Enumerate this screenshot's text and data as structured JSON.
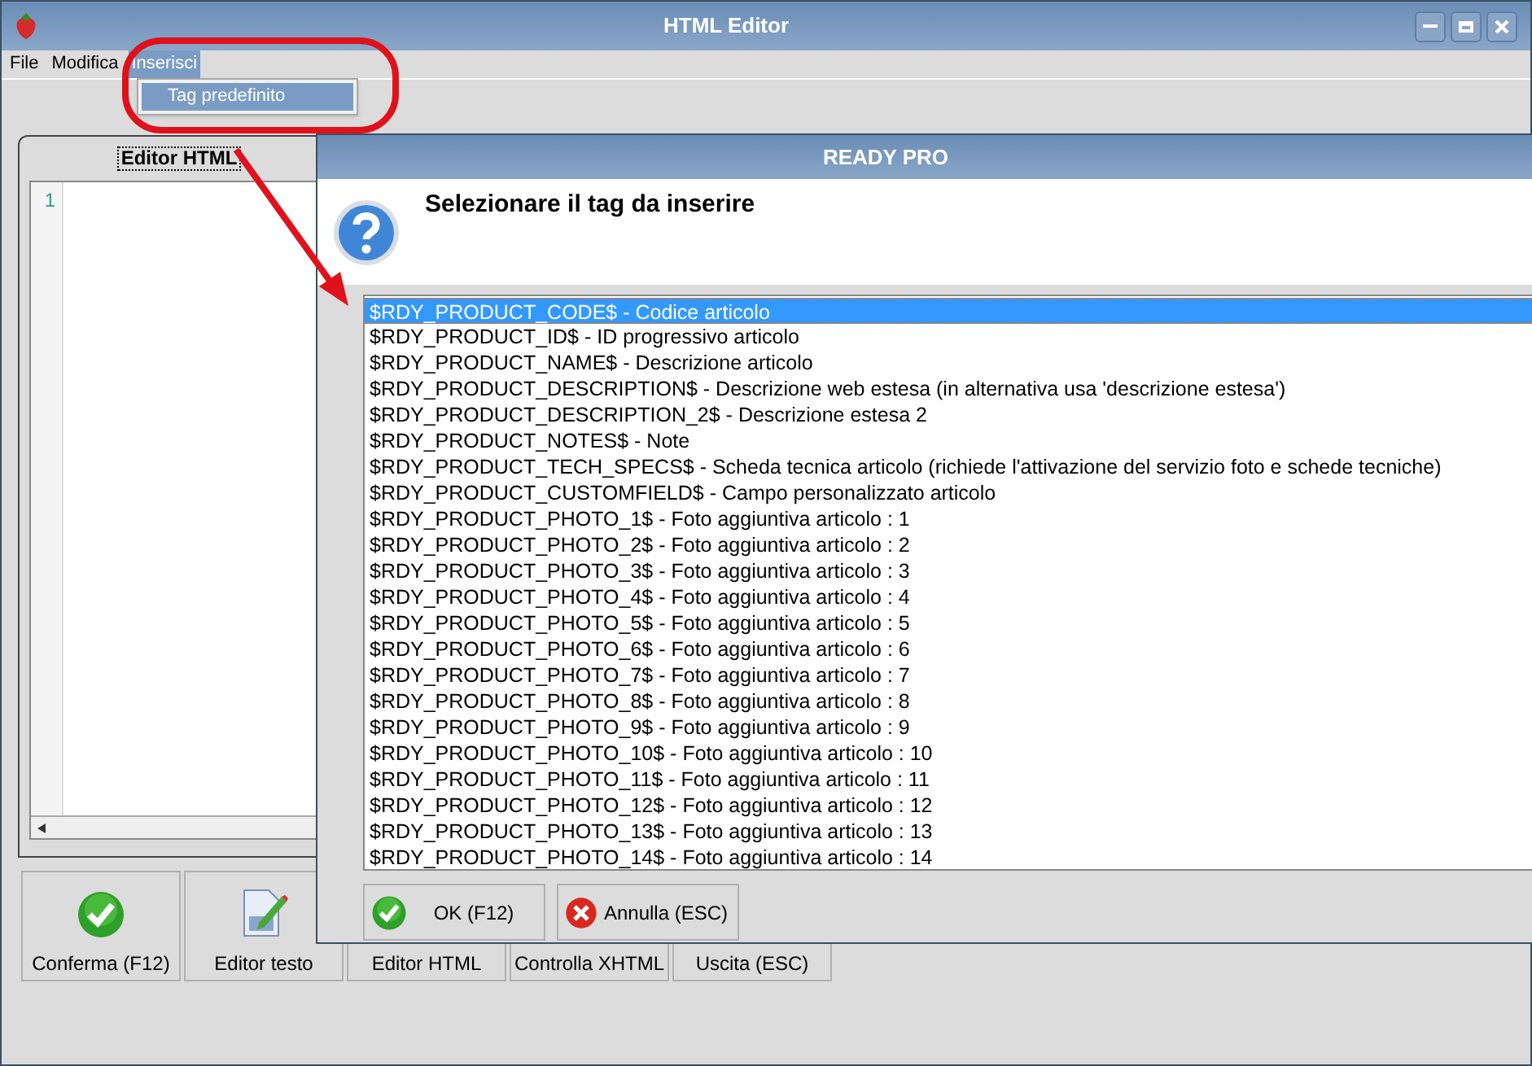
{
  "window": {
    "title": "HTML Editor"
  },
  "menu": [
    {
      "label": "File",
      "selected": false
    },
    {
      "label": "Modifica",
      "selected": false
    },
    {
      "label": "Inserisci",
      "selected": true
    }
  ],
  "dropdown": {
    "items": [
      {
        "label": "Tag predefinito",
        "selected": true
      }
    ]
  },
  "editor": {
    "tab": "Editor HTML",
    "line_numbers": [
      "1"
    ]
  },
  "bottom_buttons": [
    {
      "label": "Conferma (F12)",
      "kind": "check"
    },
    {
      "label": "Editor testo",
      "kind": "edit"
    },
    {
      "label": "Editor HTML",
      "kind": "none"
    },
    {
      "label": "Controlla XHTML",
      "kind": "none"
    },
    {
      "label": "Uscita (ESC)",
      "kind": "none"
    }
  ],
  "dialog": {
    "title": "READY PRO",
    "heading": "Selezionare il tag da inserire",
    "items": [
      {
        "label": "$RDY_PRODUCT_CODE$ - Codice articolo",
        "selected": true
      },
      {
        "label": "$RDY_PRODUCT_ID$ - ID progressivo articolo",
        "selected": false
      },
      {
        "label": "$RDY_PRODUCT_NAME$ - Descrizione articolo",
        "selected": false
      },
      {
        "label": "$RDY_PRODUCT_DESCRIPTION$ - Descrizione web estesa (in alternativa usa 'descrizione estesa')",
        "selected": false
      },
      {
        "label": "$RDY_PRODUCT_DESCRIPTION_2$ - Descrizione estesa 2",
        "selected": false
      },
      {
        "label": "$RDY_PRODUCT_NOTES$ - Note",
        "selected": false
      },
      {
        "label": "$RDY_PRODUCT_TECH_SPECS$ - Scheda tecnica articolo (richiede l'attivazione del servizio foto e schede tecniche)",
        "selected": false
      },
      {
        "label": "$RDY_PRODUCT_CUSTOMFIELD$ - Campo personalizzato articolo",
        "selected": false
      },
      {
        "label": "$RDY_PRODUCT_PHOTO_1$ - Foto aggiuntiva articolo : 1",
        "selected": false
      },
      {
        "label": "$RDY_PRODUCT_PHOTO_2$ - Foto aggiuntiva articolo : 2",
        "selected": false
      },
      {
        "label": "$RDY_PRODUCT_PHOTO_3$ - Foto aggiuntiva articolo : 3",
        "selected": false
      },
      {
        "label": "$RDY_PRODUCT_PHOTO_4$ - Foto aggiuntiva articolo : 4",
        "selected": false
      },
      {
        "label": "$RDY_PRODUCT_PHOTO_5$ - Foto aggiuntiva articolo : 5",
        "selected": false
      },
      {
        "label": "$RDY_PRODUCT_PHOTO_6$ - Foto aggiuntiva articolo : 6",
        "selected": false
      },
      {
        "label": "$RDY_PRODUCT_PHOTO_7$ - Foto aggiuntiva articolo : 7",
        "selected": false
      },
      {
        "label": "$RDY_PRODUCT_PHOTO_8$ - Foto aggiuntiva articolo : 8",
        "selected": false
      },
      {
        "label": "$RDY_PRODUCT_PHOTO_9$ - Foto aggiuntiva articolo : 9",
        "selected": false
      },
      {
        "label": "$RDY_PRODUCT_PHOTO_10$ - Foto aggiuntiva articolo : 10",
        "selected": false
      },
      {
        "label": "$RDY_PRODUCT_PHOTO_11$ - Foto aggiuntiva articolo : 11",
        "selected": false
      },
      {
        "label": "$RDY_PRODUCT_PHOTO_12$ - Foto aggiuntiva articolo : 12",
        "selected": false
      },
      {
        "label": "$RDY_PRODUCT_PHOTO_13$ - Foto aggiuntiva articolo : 13",
        "selected": false
      },
      {
        "label": "$RDY_PRODUCT_PHOTO_14$ - Foto aggiuntiva articolo : 14",
        "selected": false
      }
    ],
    "buttons": [
      {
        "label": "OK (F12)",
        "kind": "ok"
      },
      {
        "label": "Annulla (ESC)",
        "kind": "cancel"
      }
    ]
  }
}
